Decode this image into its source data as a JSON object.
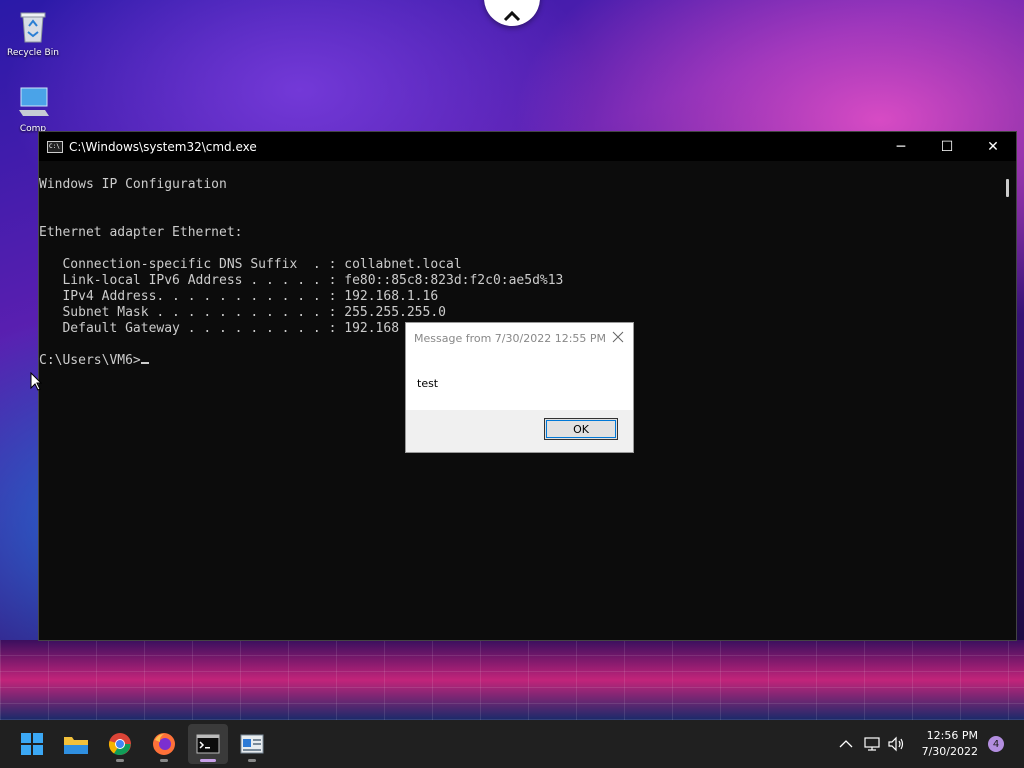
{
  "desktop": {
    "icons": [
      {
        "label": "Recycle Bin"
      },
      {
        "label": "Comp"
      }
    ]
  },
  "cmd_window": {
    "title": "C:\\Windows\\system32\\cmd.exe",
    "lines": [
      "Windows IP Configuration",
      "",
      "",
      "Ethernet adapter Ethernet:",
      "",
      "   Connection-specific DNS Suffix  . : collabnet.local",
      "   Link-local IPv6 Address . . . . . : fe80::85c8:823d:f2c0:ae5d%13",
      "   IPv4 Address. . . . . . . . . . . : 192.168.1.16",
      "   Subnet Mask . . . . . . . . . . . : 255.255.255.0",
      "   Default Gateway . . . . . . . . . : 192.168",
      ""
    ],
    "prompt": "C:\\Users\\VM6>",
    "controls": {
      "minimize": "─",
      "maximize": "☐",
      "close": "✕"
    }
  },
  "dialog": {
    "title": "Message from  7/30/2022 12:55 PM",
    "message": "test",
    "ok_label": "OK"
  },
  "taskbar": {
    "apps": [
      {
        "name": "start",
        "icon": "windows-logo-icon"
      },
      {
        "name": "file-explorer",
        "icon": "folder-icon"
      },
      {
        "name": "chrome",
        "icon": "chrome-icon"
      },
      {
        "name": "firefox",
        "icon": "firefox-icon"
      },
      {
        "name": "command-prompt",
        "icon": "terminal-icon",
        "active": true
      },
      {
        "name": "app",
        "icon": "window-app-icon"
      }
    ],
    "time": "12:56 PM",
    "date": "7/30/2022",
    "notification_count": "4"
  },
  "colors": {
    "cmd_bg": "#0c0c0c",
    "cmd_text": "#cccccc",
    "taskbar_bg": "#202020",
    "accent": "#b38ee0"
  }
}
